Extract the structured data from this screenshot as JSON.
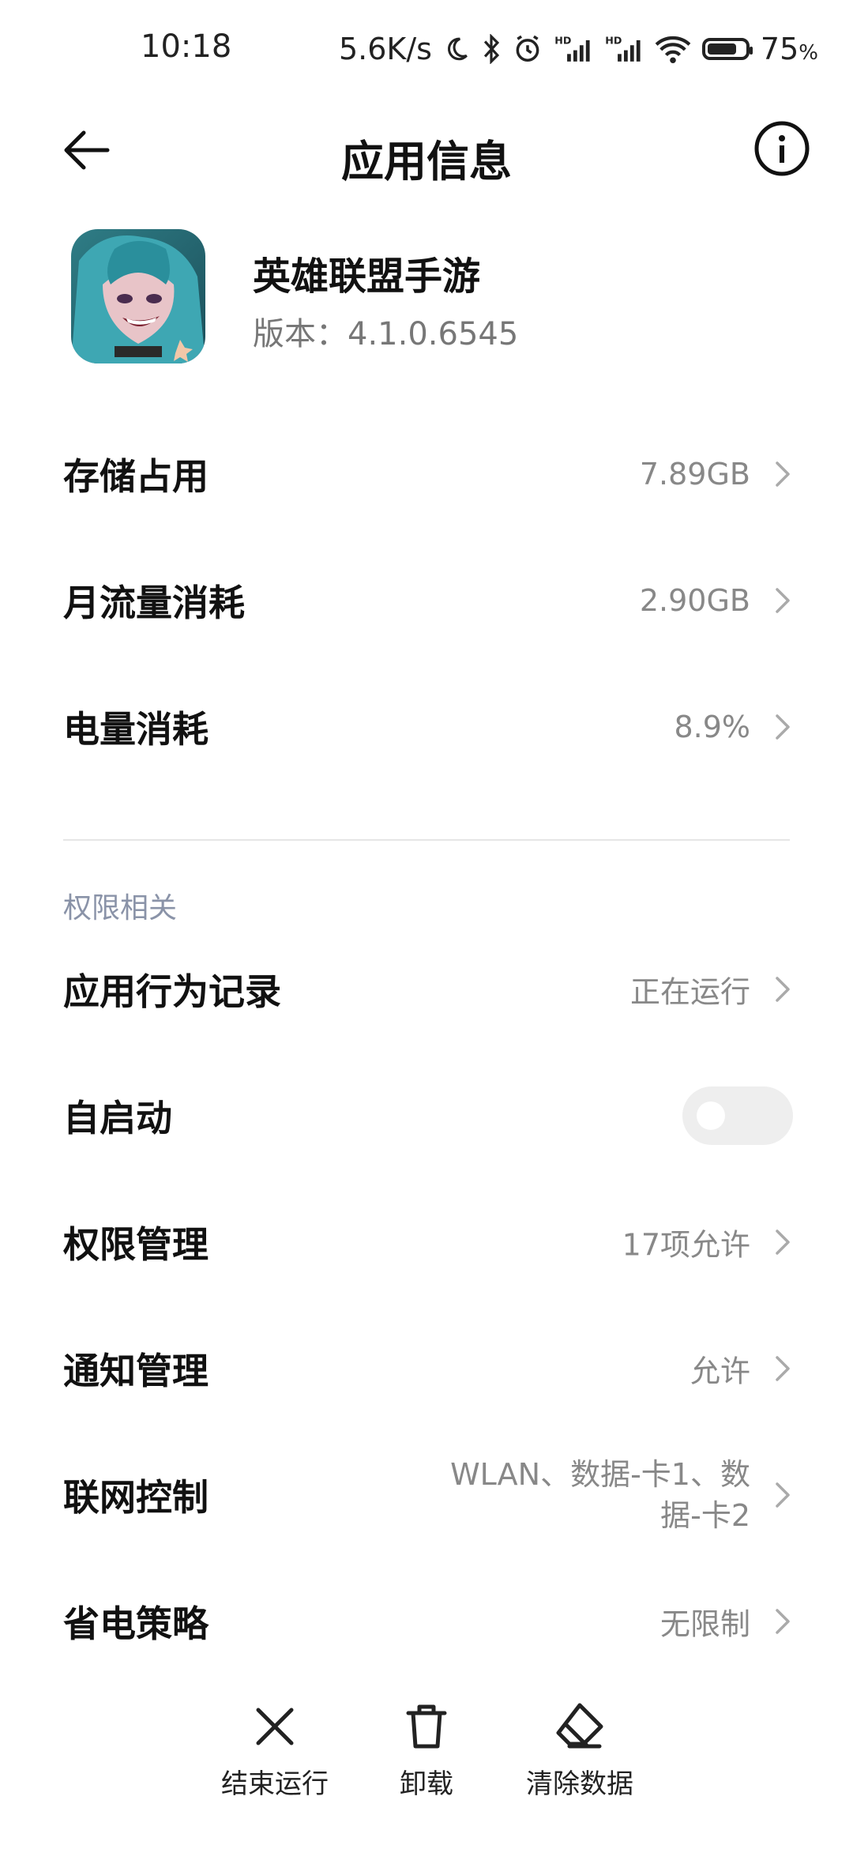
{
  "status_bar": {
    "time": "10:18",
    "net_speed": "5.6K/s",
    "battery_level": "75",
    "battery_unit": "%",
    "icons": [
      "moon-icon",
      "bluetooth-icon",
      "alarm-icon",
      "signal-hd-1-icon",
      "signal-hd-2-icon",
      "wifi-icon",
      "battery-icon"
    ]
  },
  "header": {
    "title": "应用信息",
    "back_icon": "back-arrow-icon",
    "info_icon": "info-icon"
  },
  "app": {
    "name": "英雄联盟手游",
    "version": "版本：4.1.0.6545"
  },
  "usage": [
    {
      "label": "存储占用",
      "value": "7.89GB"
    },
    {
      "label": "月流量消耗",
      "value": "2.90GB"
    },
    {
      "label": "电量消耗",
      "value": "8.9%"
    }
  ],
  "permissions": {
    "section_title": "权限相关",
    "behavior": {
      "label": "应用行为记录",
      "value": "正在运行"
    },
    "autostart": {
      "label": "自启动",
      "enabled": false
    },
    "permission_mgmt": {
      "label": "权限管理",
      "value": "17项允许"
    },
    "notification": {
      "label": "通知管理",
      "value": "允许"
    },
    "network": {
      "label": "联网控制",
      "value_line1": "WLAN、数据-卡1、数",
      "value_line2": "据-卡2"
    },
    "battery_saver": {
      "label": "省电策略",
      "value": "无限制"
    }
  },
  "bottom_bar": {
    "stop": "结束运行",
    "uninstall": "卸载",
    "clear": "清除数据"
  },
  "colors": {
    "text_primary": "#111111",
    "text_secondary": "#888888",
    "section_title": "#8a93a8",
    "toggle_off": "#eeeeee"
  }
}
